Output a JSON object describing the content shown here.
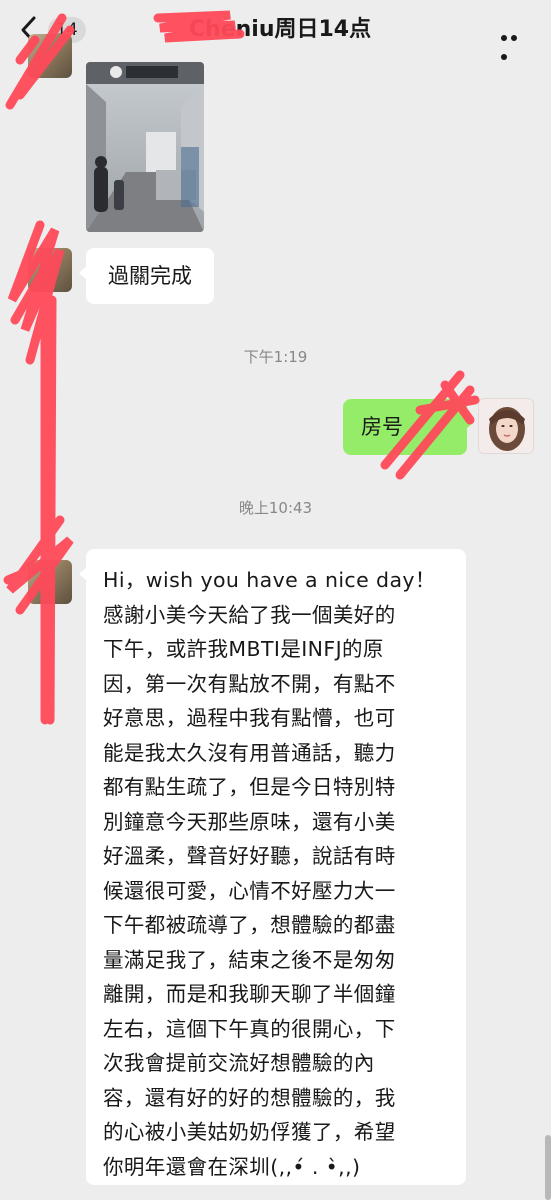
{
  "header": {
    "back_badge": "14",
    "title": "Cheniu周日14点",
    "more_icon": "more-dots-icon",
    "back_icon": "chevron-left-icon"
  },
  "messages": {
    "image_message": {
      "image": "airport-corridor-photo"
    },
    "text_1": "過關完成",
    "time_1": "下午1:19",
    "text_2": "房号",
    "time_2": "晚上10:43",
    "long_text": "Hi，wish you have a nice day！\n感謝小美今天給了我一個美好的\n下午，或許我MBTI是INFJ的原\n因，第一次有點放不開，有點不\n好意思，過程中我有點懵，也可\n能是我太久沒有用普通話，聽力\n都有點生疏了，但是今日特別特\n別鐘意今天那些原味，還有小美\n好溫柔，聲音好好聽，說話有時\n候還很可愛，心情不好壓力大一\n下午都被疏導了，想體驗的都盡\n量滿足我了，結束之後不是匆匆\n離開，而是和我聊天聊了半個鐘\n左右，這個下午真的很開心，下\n次我會提前交流好想體驗的內\n容，還有好的好的想體驗的，我\n的心被小美姑奶奶俘獲了，希望\n你明年還會在深圳(,,•́ . •̀,,)"
  },
  "colors": {
    "background": "#ededed",
    "bubble_self": "#95ec69",
    "bubble_other": "#ffffff",
    "redaction": "#ff4a5a"
  }
}
